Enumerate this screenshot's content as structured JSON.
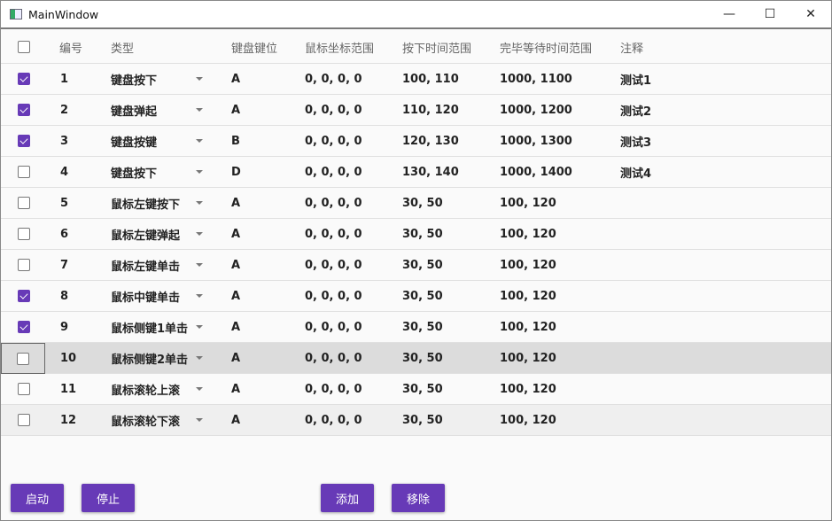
{
  "window": {
    "title": "MainWindow"
  },
  "columns": [
    "编号",
    "类型",
    "键盘键位",
    "鼠标坐标范围",
    "按下时间范围",
    "完毕等待时间范围",
    "注释"
  ],
  "rows": [
    {
      "checked": true,
      "id": "1",
      "type": "键盘按下",
      "key": "A",
      "mouse": "0, 0, 0, 0",
      "press": "100, 110",
      "wait": "1000, 1100",
      "note": "测试1"
    },
    {
      "checked": true,
      "id": "2",
      "type": "键盘弹起",
      "key": "A",
      "mouse": "0, 0, 0, 0",
      "press": "110, 120",
      "wait": "1000, 1200",
      "note": "测试2"
    },
    {
      "checked": true,
      "id": "3",
      "type": "键盘按键",
      "key": "B",
      "mouse": "0, 0, 0, 0",
      "press": "120, 130",
      "wait": "1000, 1300",
      "note": "测试3"
    },
    {
      "checked": false,
      "id": "4",
      "type": "键盘按下",
      "key": "D",
      "mouse": "0, 0, 0, 0",
      "press": "130, 140",
      "wait": "1000, 1400",
      "note": "测试4"
    },
    {
      "checked": false,
      "id": "5",
      "type": "鼠标左键按下",
      "key": "A",
      "mouse": "0, 0, 0, 0",
      "press": "30, 50",
      "wait": "100, 120",
      "note": ""
    },
    {
      "checked": false,
      "id": "6",
      "type": "鼠标左键弹起",
      "key": "A",
      "mouse": "0, 0, 0, 0",
      "press": "30, 50",
      "wait": "100, 120",
      "note": ""
    },
    {
      "checked": false,
      "id": "7",
      "type": "鼠标左键单击",
      "key": "A",
      "mouse": "0, 0, 0, 0",
      "press": "30, 50",
      "wait": "100, 120",
      "note": ""
    },
    {
      "checked": true,
      "id": "8",
      "type": "鼠标中键单击",
      "key": "A",
      "mouse": "0, 0, 0, 0",
      "press": "30, 50",
      "wait": "100, 120",
      "note": ""
    },
    {
      "checked": true,
      "id": "9",
      "type": "鼠标侧键1单击",
      "key": "A",
      "mouse": "0, 0, 0, 0",
      "press": "30, 50",
      "wait": "100, 120",
      "note": ""
    },
    {
      "checked": false,
      "id": "10",
      "type": "鼠标侧键2单击",
      "key": "A",
      "mouse": "0, 0, 0, 0",
      "press": "30, 50",
      "wait": "100, 120",
      "note": "",
      "selected": true
    },
    {
      "checked": false,
      "id": "11",
      "type": "鼠标滚轮上滚",
      "key": "A",
      "mouse": "0, 0, 0, 0",
      "press": "30, 50",
      "wait": "100, 120",
      "note": ""
    },
    {
      "checked": false,
      "id": "12",
      "type": "鼠标滚轮下滚",
      "key": "A",
      "mouse": "0, 0, 0, 0",
      "press": "30, 50",
      "wait": "100, 120",
      "note": "",
      "hover": true
    }
  ],
  "buttons": {
    "start": "启动",
    "stop": "停止",
    "add": "添加",
    "remove": "移除"
  },
  "colors": {
    "accent": "#673ab7",
    "selected_row": "#dcdcdc"
  }
}
